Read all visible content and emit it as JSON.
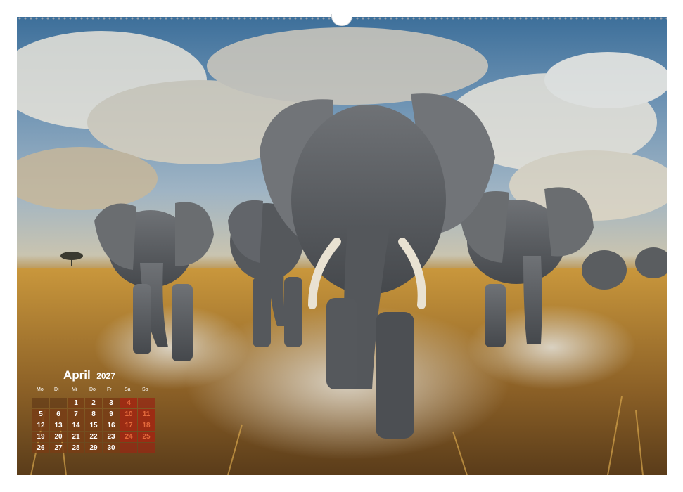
{
  "calendar": {
    "month": "April",
    "year": "2027",
    "weekdays": [
      "Mo",
      "Di",
      "Mi",
      "Do",
      "Fr",
      "Sa",
      "So"
    ],
    "weeks": [
      [
        "",
        "",
        "1",
        "2",
        "3",
        "4",
        ""
      ],
      [
        "5",
        "6",
        "7",
        "8",
        "9",
        "10",
        "11"
      ],
      [
        "12",
        "13",
        "14",
        "15",
        "16",
        "17",
        "18"
      ],
      [
        "19",
        "20",
        "21",
        "22",
        "23",
        "24",
        "25"
      ],
      [
        "26",
        "27",
        "28",
        "29",
        "30",
        "",
        ""
      ]
    ]
  },
  "photo": {
    "subject": "elephant herd charging through savanna grass",
    "colors": {
      "sky_top": "#3d6f9a",
      "cloud": "#e8e4da",
      "grass": "#b7842f",
      "elephant": "#5f6266",
      "dust": "#cfcac0"
    }
  }
}
